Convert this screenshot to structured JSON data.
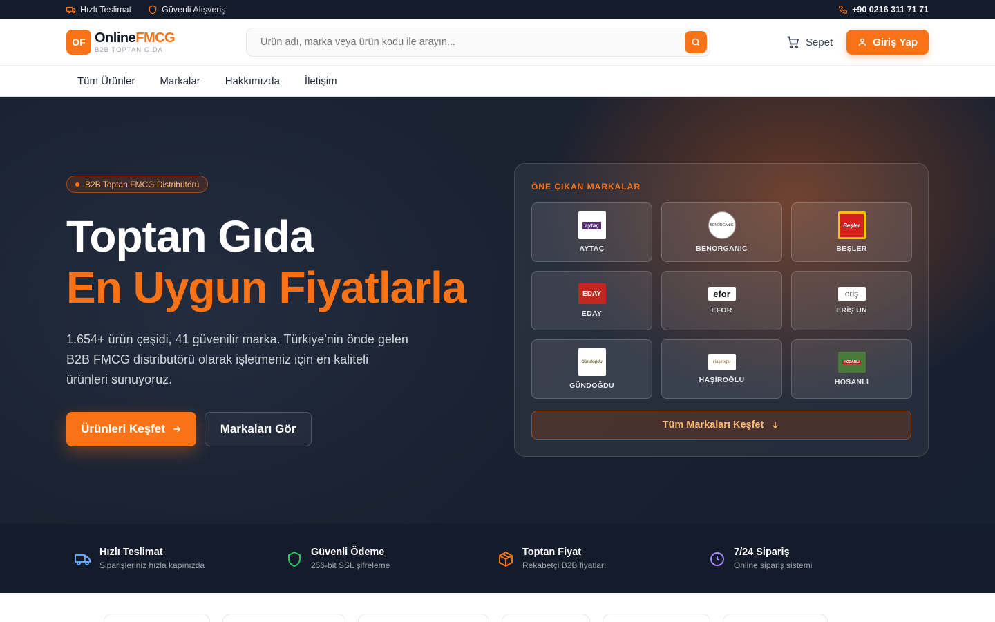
{
  "topbar": {
    "fast_delivery": "Hızlı Teslimat",
    "secure_shopping": "Güvenli Alışveriş",
    "phone": "+90 0216 311 71 71"
  },
  "header": {
    "logo_mark": "OF",
    "logo_name_a": "Online",
    "logo_name_b": "FMCG",
    "logo_sub": "B2B TOPTAN GIDA",
    "search_placeholder": "Ürün adı, marka veya ürün kodu ile arayın...",
    "cart_label": "Sepet",
    "login_label": "Giriş Yap"
  },
  "nav": {
    "items": [
      "Tüm Ürünler",
      "Markalar",
      "Hakkımızda",
      "İletişim"
    ]
  },
  "hero": {
    "badge": "B2B Toptan FMCG Distribütörü",
    "title_line1": "Toptan Gıda",
    "title_line2": "En Uygun Fiyatlarla",
    "description": "1.654+ ürün çeşidi, 41 güvenilir marka. Türkiye'nin önde gelen B2B FMCG distribütörü olarak işletmeniz için en kaliteli ürünleri sunuyoruz.",
    "primary_button": "Ürünleri Keşfet",
    "secondary_button": "Markaları Gör"
  },
  "brands_panel": {
    "title": "ÖNE ÇIKAN MARKALAR",
    "brands": [
      {
        "name": "AYTAÇ",
        "logo_text": "aytaç"
      },
      {
        "name": "BENORGANIC",
        "logo_text": "BENORGANIC"
      },
      {
        "name": "BEŞLER",
        "logo_text": "Beşler"
      },
      {
        "name": "EDAY",
        "logo_text": "EDAY"
      },
      {
        "name": "EFOR",
        "logo_text": "efor"
      },
      {
        "name": "ERİŞ UN",
        "logo_text": "eriş"
      },
      {
        "name": "GÜNDOĞDU",
        "logo_text": "Gündoğdu"
      },
      {
        "name": "HAŞİROĞLU",
        "logo_text": "Haşiroğlu"
      },
      {
        "name": "HOSANLI",
        "logo_text": "HOSANLI"
      }
    ],
    "explore_button": "Tüm Markaları Keşfet"
  },
  "features": [
    {
      "title": "Hızlı Teslimat",
      "subtitle": "Siparişleriniz hızla kapınızda",
      "icon": "truck-icon",
      "color": "#60a5fa"
    },
    {
      "title": "Güvenli Ödeme",
      "subtitle": "256-bit SSL şifreleme",
      "icon": "shield-icon",
      "color": "#22c55e"
    },
    {
      "title": "Toptan Fiyat",
      "subtitle": "Rekabetçi B2B fiyatları",
      "icon": "box-icon",
      "color": "#f97316"
    },
    {
      "title": "7/24 Sipariş",
      "subtitle": "Online sipariş sistemi",
      "icon": "clock-icon",
      "color": "#a78bfa"
    }
  ],
  "colors": {
    "accent": "#f97316",
    "dark": "#141b2b"
  }
}
